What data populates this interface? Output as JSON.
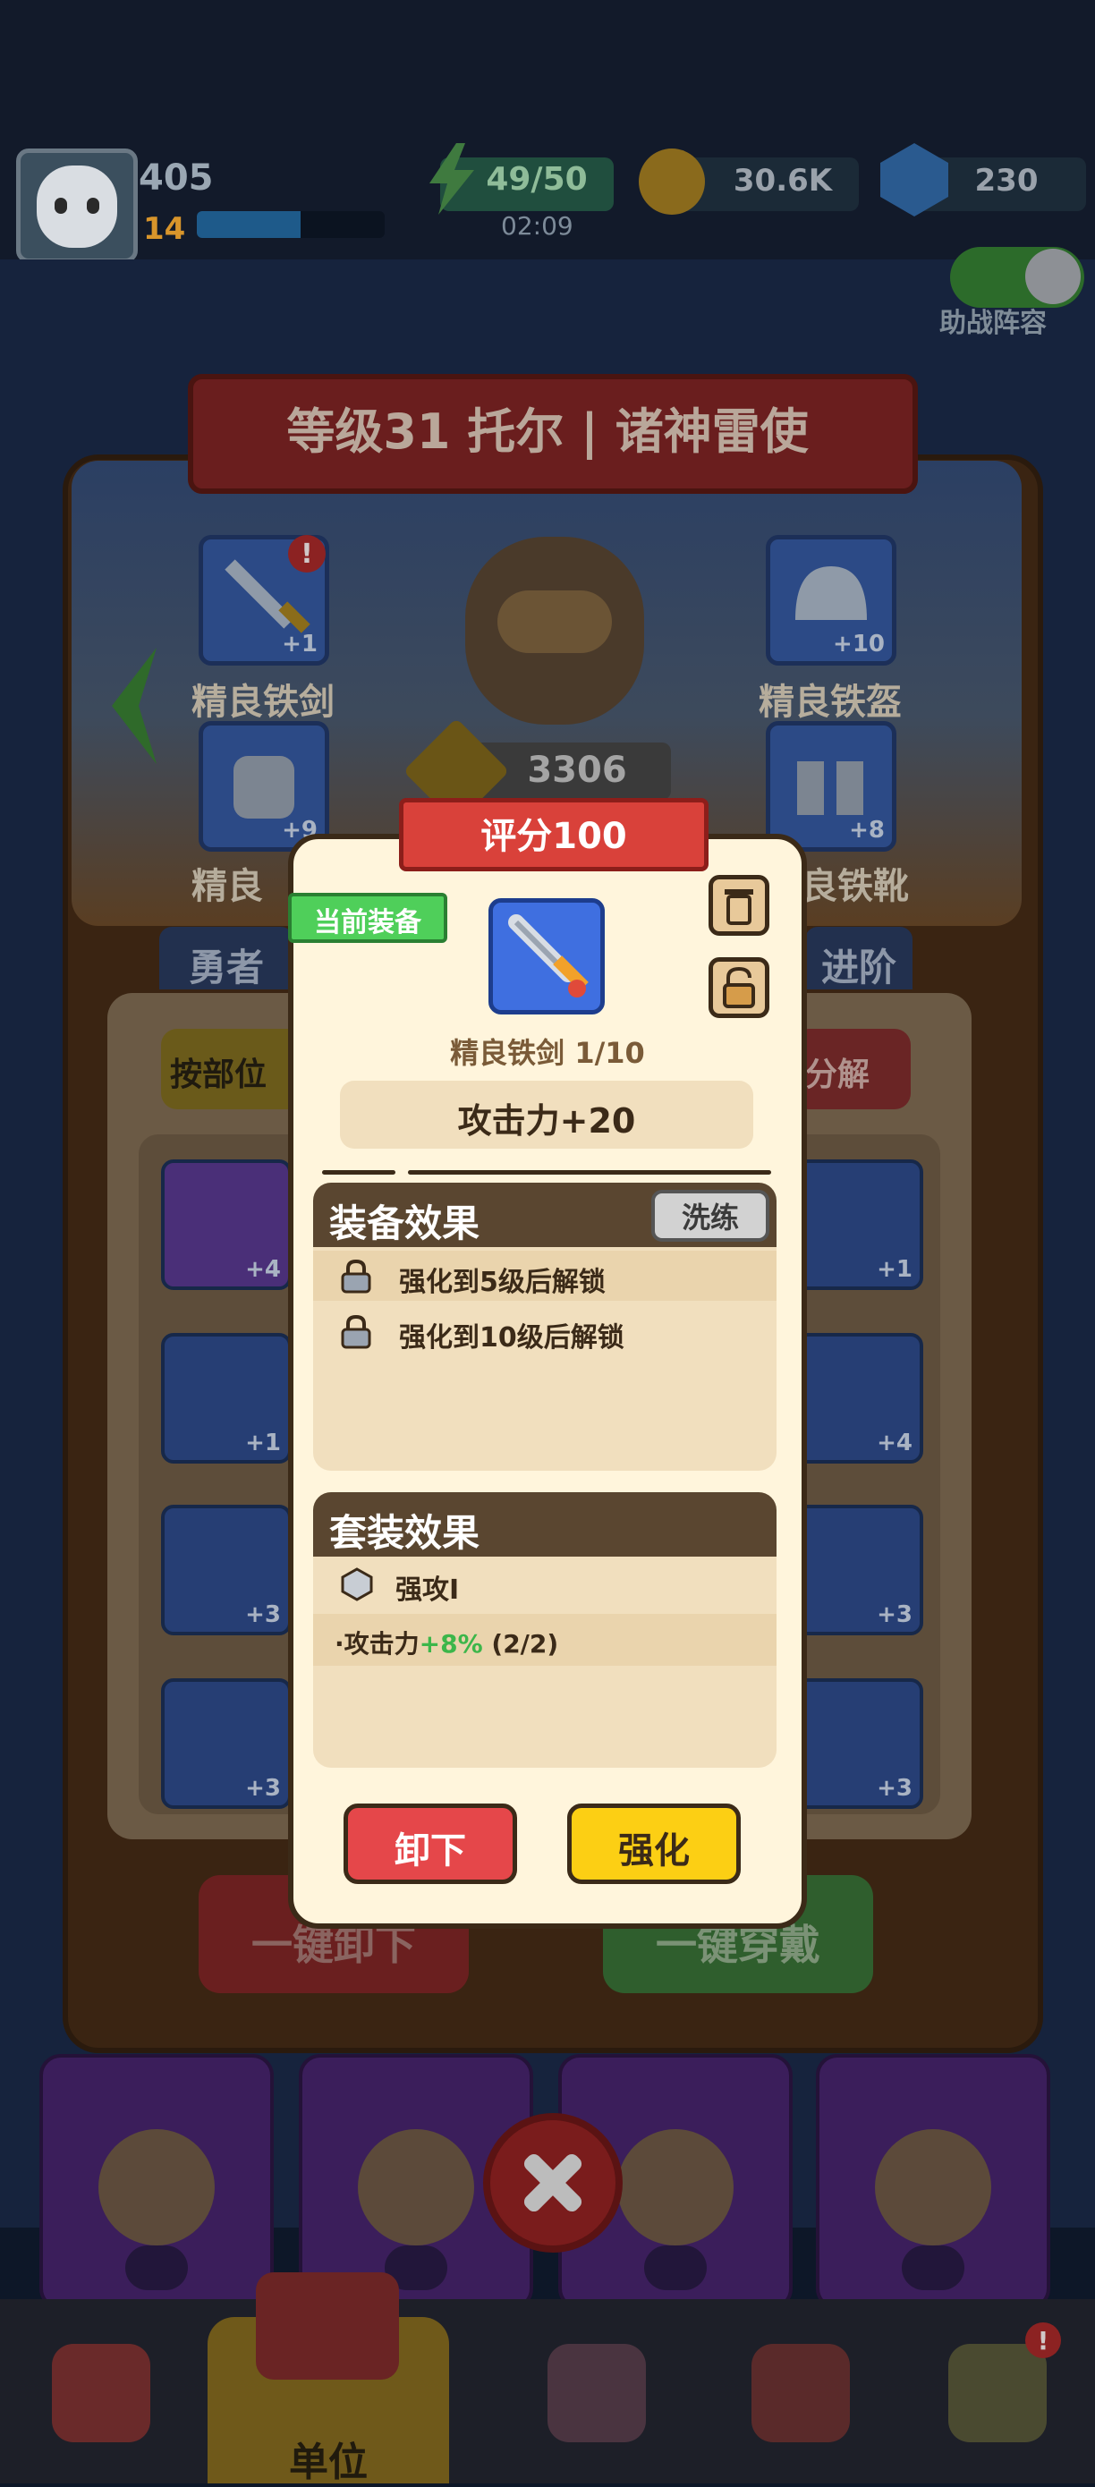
{
  "player": {
    "power": "405",
    "level": "14",
    "xp_fraction": 0.55
  },
  "resources": {
    "energy": "49/50",
    "energy_timer": "02:09",
    "gold": "30.6K",
    "gems": "230"
  },
  "assist_toggle": {
    "label": "助战阵容",
    "on": true
  },
  "hero": {
    "title": "等级31 托尔 | 诸神雷使",
    "score": "3306"
  },
  "equipment_slots": [
    {
      "name": "精良铁剑",
      "plus": "+1",
      "icon": "sword-icon",
      "alert": true
    },
    {
      "name": "精良铁盔",
      "plus": "+10",
      "icon": "helmet-icon",
      "alert": false
    },
    {
      "name": "精良",
      "plus": "+9",
      "icon": "armor-icon",
      "alert": false
    },
    {
      "name": "良铁靴",
      "plus": "+8",
      "icon": "boots-icon",
      "alert": false
    }
  ],
  "tabs": {
    "left": "勇者",
    "right": "进阶"
  },
  "inventory": {
    "sort_label": "按部位",
    "decompose_label": "分解",
    "left_items": [
      "+4",
      "+1",
      "+3",
      "+3"
    ],
    "right_items": [
      "+1",
      "+4",
      "+3",
      "+3"
    ],
    "unequip_all": "一键卸下",
    "equip_all": "一键穿戴"
  },
  "modal": {
    "score_label": "评分100",
    "current_badge": "当前装备",
    "item_name": "精良铁剑 1/10",
    "stat": "攻击力+20",
    "equip_effects_title": "装备效果",
    "refine_label": "洗练",
    "effects": [
      "强化到5级后解锁",
      "强化到10级后解锁"
    ],
    "set_effects_title": "套装效果",
    "set_name": "强攻I",
    "set_bonus_prefix": "·攻击力",
    "set_bonus_value": "+8%",
    "set_bonus_count": "(2/2)",
    "unequip_label": "卸下",
    "upgrade_label": "强化"
  },
  "bottom_nav": {
    "active_label": "单位"
  },
  "colors": {
    "modal_bg": "#fff5dc",
    "red_button": "#e5474a",
    "yellow_button": "#fccf14",
    "green_badge": "#4fcf5a"
  }
}
